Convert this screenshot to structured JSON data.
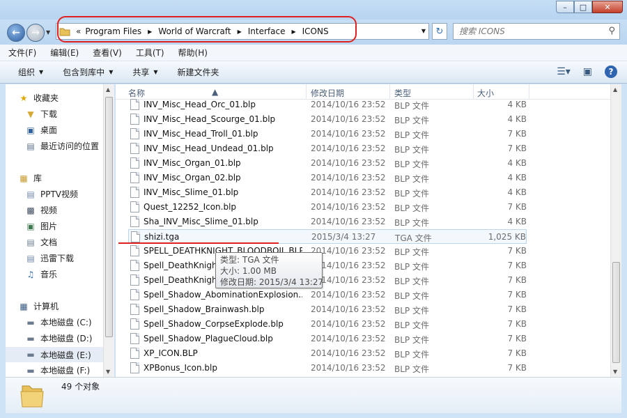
{
  "window": {
    "minimize": "–",
    "maximize": "□",
    "close": "✕"
  },
  "address": {
    "crumbs": [
      "Program Files",
      "World of Warcraft",
      "Interface",
      "ICONS"
    ],
    "overflow": "«"
  },
  "search": {
    "placeholder": "搜索 ICONS"
  },
  "menu": [
    "文件(F)",
    "编辑(E)",
    "查看(V)",
    "工具(T)",
    "帮助(H)"
  ],
  "commands": {
    "organize": "组织",
    "include_library": "包含到库中",
    "share": "共享",
    "new_folder": "新建文件夹"
  },
  "nav": {
    "favorites": "收藏夹",
    "downloads": "下载",
    "desktop": "桌面",
    "recent": "最近访问的位置",
    "libraries": "库",
    "pptv": "PPTV视频",
    "videos": "视频",
    "pictures": "图片",
    "documents": "文档",
    "xunlei": "迅雷下载",
    "music": "音乐",
    "computer": "计算机",
    "disk_c": "本地磁盘 (C:)",
    "disk_d": "本地磁盘 (D:)",
    "disk_e": "本地磁盘 (E:)",
    "disk_f": "本地磁盘 (F:)"
  },
  "columns": {
    "name": "名称",
    "date": "修改日期",
    "type": "类型",
    "size": "大小"
  },
  "files": [
    {
      "name": "INV_Misc_Head_Orc_01.blp",
      "date": "2014/10/16 23:52",
      "type": "BLP 文件",
      "size": "4 KB"
    },
    {
      "name": "INV_Misc_Head_Scourge_01.blp",
      "date": "2014/10/16 23:52",
      "type": "BLP 文件",
      "size": "4 KB"
    },
    {
      "name": "INV_Misc_Head_Troll_01.blp",
      "date": "2014/10/16 23:52",
      "type": "BLP 文件",
      "size": "7 KB"
    },
    {
      "name": "INV_Misc_Head_Undead_01.blp",
      "date": "2014/10/16 23:52",
      "type": "BLP 文件",
      "size": "7 KB"
    },
    {
      "name": "INV_Misc_Organ_01.blp",
      "date": "2014/10/16 23:52",
      "type": "BLP 文件",
      "size": "4 KB"
    },
    {
      "name": "INV_Misc_Organ_02.blp",
      "date": "2014/10/16 23:52",
      "type": "BLP 文件",
      "size": "4 KB"
    },
    {
      "name": "INV_Misc_Slime_01.blp",
      "date": "2014/10/16 23:52",
      "type": "BLP 文件",
      "size": "4 KB"
    },
    {
      "name": "Quest_12252_Icon.blp",
      "date": "2014/10/16 23:52",
      "type": "BLP 文件",
      "size": "7 KB"
    },
    {
      "name": "Sha_INV_Misc_Slime_01.blp",
      "date": "2014/10/16 23:52",
      "type": "BLP 文件",
      "size": "4 KB"
    },
    {
      "name": "shizi.tga",
      "date": "2015/3/4 13:27",
      "type": "TGA 文件",
      "size": "1,025 KB"
    },
    {
      "name": "SPELL_DEATHKNIGHT_BLOODBOIL.BLP",
      "date": "2014/10/16 23:52",
      "type": "BLP 文件",
      "size": "7 KB"
    },
    {
      "name": "Spell_DeathKnight",
      "date": "2014/10/16 23:52",
      "type": "BLP 文件",
      "size": "7 KB"
    },
    {
      "name": "Spell_DeathKnight",
      "date": "2014/10/16 23:52",
      "type": "BLP 文件",
      "size": "7 KB"
    },
    {
      "name": "Spell_Shadow_AbominationExplosion....",
      "date": "2014/10/16 23:52",
      "type": "BLP 文件",
      "size": "7 KB"
    },
    {
      "name": "Spell_Shadow_Brainwash.blp",
      "date": "2014/10/16 23:52",
      "type": "BLP 文件",
      "size": "7 KB"
    },
    {
      "name": "Spell_Shadow_CorpseExplode.blp",
      "date": "2014/10/16 23:52",
      "type": "BLP 文件",
      "size": "7 KB"
    },
    {
      "name": "Spell_Shadow_PlagueCloud.blp",
      "date": "2014/10/16 23:52",
      "type": "BLP 文件",
      "size": "7 KB"
    },
    {
      "name": "XP_ICON.BLP",
      "date": "2014/10/16 23:52",
      "type": "BLP 文件",
      "size": "7 KB"
    },
    {
      "name": "XPBonus_Icon.blp",
      "date": "2014/10/16 23:52",
      "type": "BLP 文件",
      "size": "7 KB"
    }
  ],
  "tooltip": {
    "type": "类型: TGA 文件",
    "size": "大小: 1.00 MB",
    "date": "修改日期: 2015/3/4 13:27"
  },
  "status": {
    "count": "49 个对象"
  },
  "colors": {
    "annotation_red": "#e02020",
    "hover_border": "#b8d6f0"
  }
}
